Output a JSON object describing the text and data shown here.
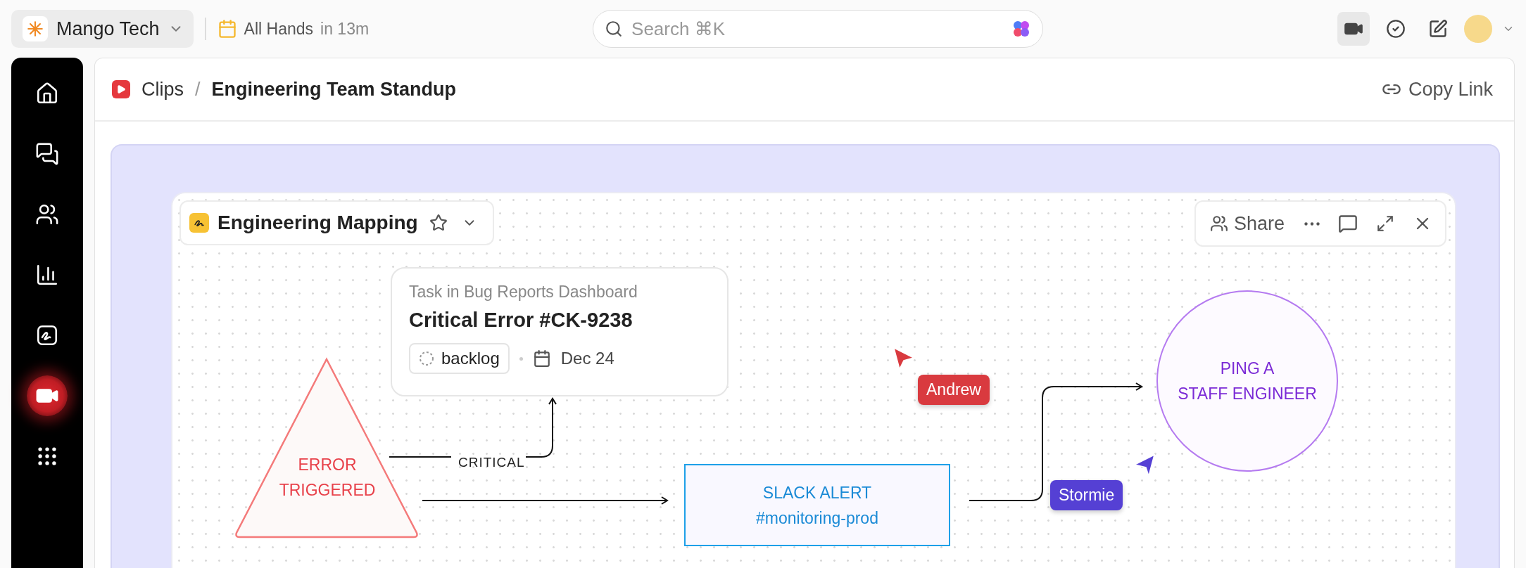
{
  "workspace": {
    "name": "Mango Tech"
  },
  "event": {
    "title": "All Hands",
    "time": "in 13m"
  },
  "search": {
    "placeholder": "Search ⌘K"
  },
  "sidebar": {
    "items": [
      {
        "selected": false
      },
      {
        "selected": false
      },
      {
        "selected": false
      },
      {
        "selected": false
      },
      {
        "selected": false
      },
      {
        "selected": true
      },
      {
        "selected": false
      }
    ]
  },
  "breadcrumb": {
    "section": "Clips",
    "separator": "/",
    "page": "Engineering Team Standup"
  },
  "copy_link": "Copy Link",
  "whiteboard": {
    "title": "Engineering Mapping",
    "share": "Share",
    "task_card": {
      "subtitle": "Task in Bug Reports Dashboard",
      "title": "Critical Error #CK-9238",
      "status": "backlog",
      "date": "Dec 24"
    },
    "trigger": "ERROR\nTRIGGERED",
    "edge_label": "CRITICAL",
    "slack": "SLACK ALERT\n#monitoring-prod",
    "ping": "PING A\nSTAFF ENGINEER",
    "cursors": [
      {
        "name": "Andrew",
        "color": "#d93a3f"
      },
      {
        "name": "Stormie",
        "color": "#5540d4"
      }
    ]
  }
}
